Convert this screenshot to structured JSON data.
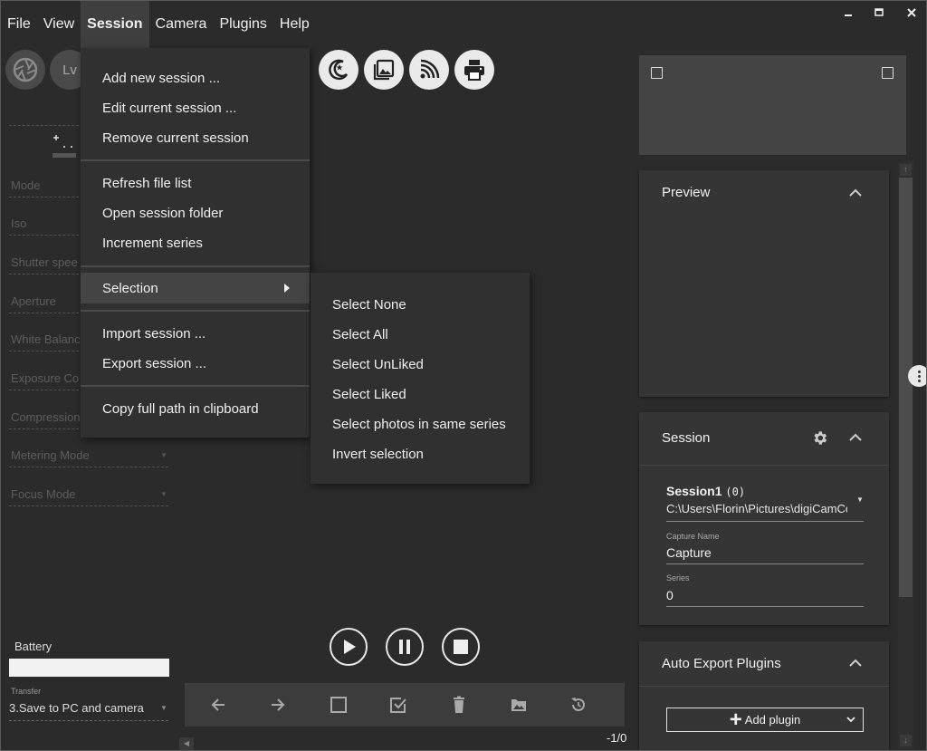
{
  "menubar": {
    "items": [
      "File",
      "View",
      "Session",
      "Camera",
      "Plugins",
      "Help"
    ],
    "active": "Session"
  },
  "toolbar": {
    "lv_label": "Lv",
    "icons": [
      "aperture-icon",
      "live-view-icon",
      "night-mode-icon",
      "gallery-icon",
      "wifi-icon",
      "printer-icon"
    ]
  },
  "left_panel": {
    "fields": [
      "Mode",
      "Iso",
      "Shutter spee",
      "Aperture",
      "White Balanc",
      "Exposure Co",
      "Compression",
      "Metering Mode",
      "Focus Mode"
    ],
    "battery_label": "Battery",
    "transfer_label": "Transfer",
    "transfer_value": "3.Save to PC and camera"
  },
  "session_menu": {
    "items": [
      "Add new session ...",
      "Edit current session ...",
      "Remove current session",
      "Refresh file list",
      "Open session folder",
      "Increment series",
      "Selection",
      "Import session ...",
      "Export session ...",
      "Copy full path in clipboard"
    ]
  },
  "selection_submenu": {
    "items": [
      "Select None",
      "Select All",
      "Select UnLiked",
      "Select Liked",
      "Select photos in same series",
      "Invert selection"
    ]
  },
  "preview": {
    "title": "Preview"
  },
  "session_panel": {
    "title": "Session",
    "name": "Session1",
    "count": "(0)",
    "path": "C:\\Users\\Florin\\Pictures\\digiCamControl",
    "capture_name_label": "Capture Name",
    "capture_name_value": "Capture",
    "series_label": "Series",
    "series_value": "0"
  },
  "auto_export": {
    "title": "Auto Export Plugins",
    "add_plugin_label": "Add plugin"
  },
  "viewer": {
    "counter": "-1/0"
  },
  "colors": {
    "background": "#2b2b2b",
    "panel": "#353535",
    "menu": "#303030",
    "highlight": "#444444"
  }
}
